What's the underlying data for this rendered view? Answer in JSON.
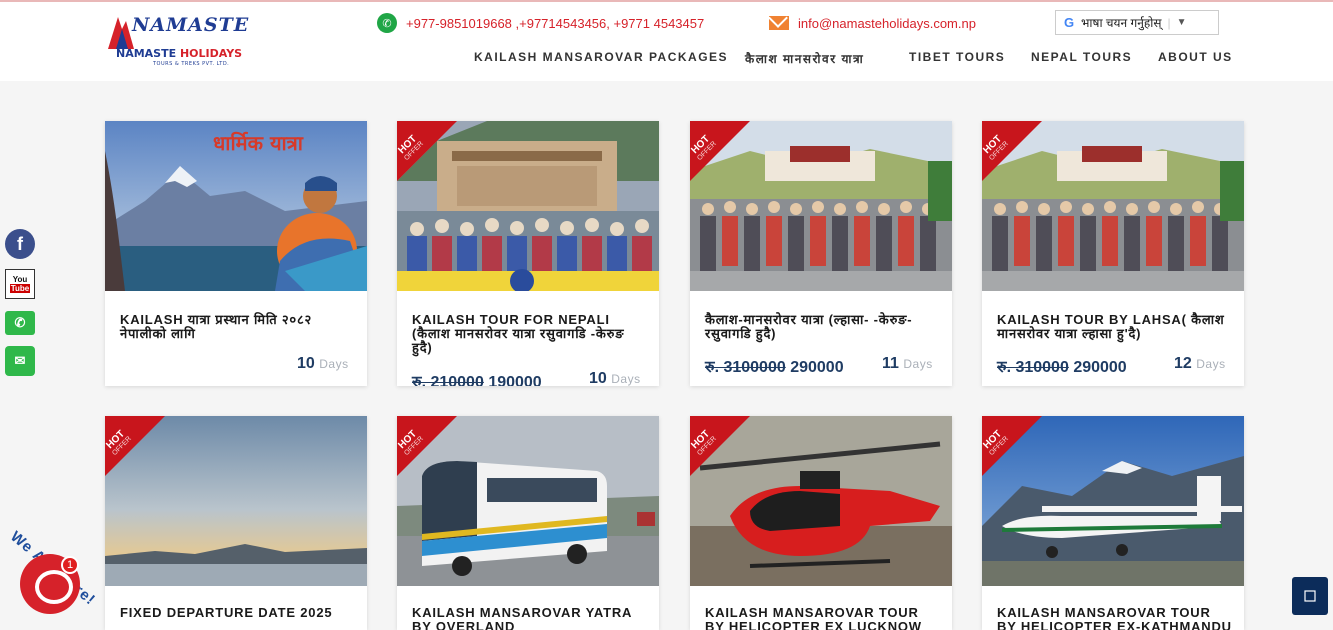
{
  "header": {
    "logo": {
      "script": "NAMASTE",
      "name_main": "NAMASTE ",
      "name_accent": "HOLIDAYS",
      "sub": "TOURS & TREKS PVT. LTD."
    },
    "phone": "+977-9851019668 ,+97714543456, +9771 4543457",
    "email": "info@namasteholidays.com.np",
    "language": {
      "label": "भाषा चयन गर्नुहोस्",
      "sep": "|",
      "arrow": "▼"
    }
  },
  "nav": [
    "KAILASH MANSAROVAR PACKAGES",
    "कैलाश मानसरोवर यात्रा",
    "TIBET TOURS",
    "NEPAL TOURS",
    "ABOUT US"
  ],
  "ribbon": {
    "main": "HOT",
    "sub": "OFFER"
  },
  "cards": [
    {
      "title": "KAILASH यात्रा प्रस्थान मिति २०८२ नेपालीको लागि",
      "old_price": "",
      "price": "",
      "days": "10",
      "days_label": "Days",
      "hot": false,
      "image_caption": "धार्मिक यात्रा"
    },
    {
      "title": "Kailash Tour for Nepali (कैलाश मानसरोवर यात्रा रसुवागडि -केरुङ हुदै)",
      "old_price": "रु. 210000",
      "price": "190000",
      "days": "10",
      "days_label": "Days",
      "hot": true
    },
    {
      "title": "कैलाश-मानसरोवर यात्रा (ल्हासा- -केरुङ- रसुवागडि हुदै)",
      "old_price": "रु. 3100000",
      "price": "290000",
      "days": "11",
      "days_label": "Days",
      "hot": true
    },
    {
      "title": "Kailash Tour By Lahsa( कैलाश मानसरोवर यात्रा ल्हासा हु'दै)",
      "old_price": "रु. 310000",
      "price": "290000",
      "days": "12",
      "days_label": "Days",
      "hot": true
    },
    {
      "title": "Fixed Departure Date 2025",
      "hot": true
    },
    {
      "title": "Kailash Mansarovar Yatra By Overland",
      "hot": true
    },
    {
      "title": "Kailash Mansarovar Tour By Helicopter Ex Lucknow",
      "hot": true
    },
    {
      "title": "Kailash Mansarovar Tour By Helicopter Ex-Kathmandu",
      "hot": true
    }
  ],
  "social": {
    "facebook": "f",
    "youtube_top": "You",
    "youtube_bottom": "Tube",
    "whatsapp": "✆",
    "wechat": "✉"
  },
  "chat": {
    "badge": "1",
    "tagline": "We Are Here!"
  },
  "colors": {
    "accent_red": "#d6222a",
    "brand_blue": "#1f3c93",
    "price_navy": "#1f3c63",
    "hot_ribbon": "#c8151c"
  }
}
